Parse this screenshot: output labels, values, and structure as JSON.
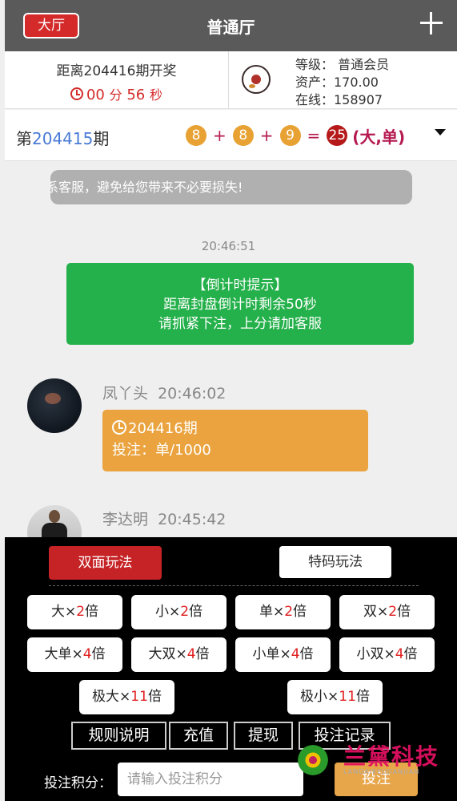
{
  "header": {
    "hall_label": "大厅",
    "title": "普通厅"
  },
  "info": {
    "countdown_label": "距离204416期开奖",
    "countdown_min": "00",
    "min_unit": "分",
    "countdown_sec": "56",
    "sec_unit": "秒",
    "level": "等级： 普通会员",
    "assets": "资产：170.00",
    "online": "在线：158907"
  },
  "period": {
    "prefix": "第",
    "number": "204415",
    "suffix": "期",
    "balls": [
      "8",
      "8",
      "9"
    ],
    "plus": "+",
    "equals": "=",
    "sum": "25",
    "tag": "(大,单)"
  },
  "notice": "系客服，避免给您带来不必要损失!",
  "system_msg": {
    "time": "20:46:51",
    "line1": "【倒计时提示】",
    "line2": "距离封盘倒计时剩余50秒",
    "line3": "请抓紧下注，上分请加客服"
  },
  "messages": [
    {
      "name": "凤丫头",
      "time": "20:46:02",
      "period": "204416期",
      "bet": "投注：单/1000"
    },
    {
      "name": "李达明",
      "time": "20:45:42"
    }
  ],
  "panel": {
    "tab_active": "双面玩法",
    "tab_inactive": "特码玩法",
    "options": [
      {
        "label": "大",
        "x": "×",
        "mult": "2",
        "unit": "倍"
      },
      {
        "label": "小",
        "x": "×",
        "mult": "2",
        "unit": "倍"
      },
      {
        "label": "单",
        "x": "×",
        "mult": "2",
        "unit": "倍"
      },
      {
        "label": "双",
        "x": "×",
        "mult": "2",
        "unit": "倍"
      },
      {
        "label": "大单",
        "x": "×",
        "mult": "4",
        "unit": "倍"
      },
      {
        "label": "大双",
        "x": "×",
        "mult": "4",
        "unit": "倍"
      },
      {
        "label": "小单",
        "x": "×",
        "mult": "4",
        "unit": "倍"
      },
      {
        "label": "小双",
        "x": "×",
        "mult": "4",
        "unit": "倍"
      },
      {
        "label": "极大",
        "x": "×",
        "mult": "11",
        "unit": "倍"
      },
      {
        "label": "极小",
        "x": "×",
        "mult": "11",
        "unit": "倍"
      }
    ],
    "actions": [
      "规则说明",
      "充值",
      "提现",
      "投注记录"
    ],
    "bet_label": "投注积分：",
    "bet_placeholder": "请输入投注积分",
    "submit": "投注"
  },
  "watermark": {
    "text": "兰黛科技",
    "sub": "LANDAIKEJIJIANJIAN"
  }
}
